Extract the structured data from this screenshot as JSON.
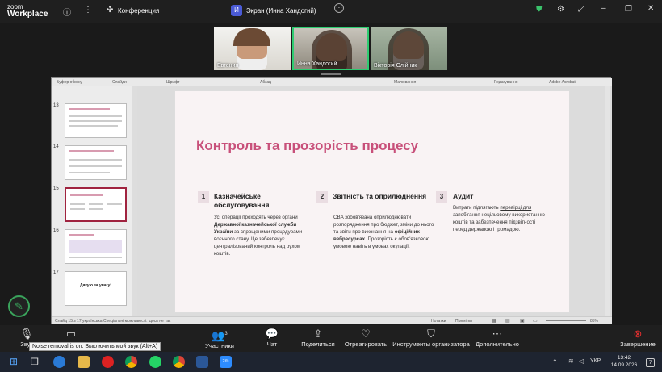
{
  "app": {
    "brand_line1": "zoom",
    "brand_line2": "Workplace"
  },
  "topbar": {
    "meeting_title": "Конференция",
    "share_label": "Экран (Инна Хандогий)",
    "share_avatar_letter": "И"
  },
  "participants": [
    {
      "name": "Евгения"
    },
    {
      "name": "Инна Хандогий"
    },
    {
      "name": "Вікторія Олійник"
    }
  ],
  "ribbon": {
    "items": [
      "Буфер обміну",
      "Слайди",
      "Шрифт",
      "Абзац",
      "Малювання",
      "Редагування",
      "Adobe Acrobat"
    ]
  },
  "thumbnails": [
    {
      "num": "13"
    },
    {
      "num": "14"
    },
    {
      "num": "15"
    },
    {
      "num": "16"
    },
    {
      "num": "17",
      "text": "Дякую за увагу!"
    }
  ],
  "slide": {
    "title": "Контроль та прозорість процесу",
    "columns": [
      {
        "num": "1",
        "heading": "Казначейське обслуговування",
        "text_pre": "Усі операції проходять через органи ",
        "text_bold": "Державної казначейської служби України",
        "text_post": " за спрощеними процедурами воєнного стану. Це забезпечує централізований контроль над рухом коштів."
      },
      {
        "num": "2",
        "heading": "Звітність та оприлюднення",
        "text_pre": "CBA зобов'язана оприлюднювати розпорядження про бюджет, зміни до нього та звіти про виконання на ",
        "text_bold": "офіційних вебресурсах",
        "text_post": ". Прозорість є обов'язковою умовою навіть в умовах окупації."
      },
      {
        "num": "3",
        "heading": "Аудит",
        "text_pre": "Витрати підлягають ",
        "text_bold": "перевірці для",
        "text_post": " запобігання нецільовому використанню коштів та забезпечення підзвітності перед державою і громадою."
      }
    ]
  },
  "statusbar": {
    "left": "Слайд 15 з 17   українська   Спеціальні можливості: щось не так",
    "notes": "Нотатки",
    "comments": "Примітки",
    "zoom": "85%"
  },
  "bottombar": {
    "audio": "Звук",
    "participants": "Участники",
    "participants_count": "3",
    "chat": "Чат",
    "share": "Поделиться",
    "react": "Отреагировать",
    "host_tools": "Инструменты организатора",
    "more": "Дополнительно",
    "end": "Завершение"
  },
  "tooltip": "Noise removal is on. Выключить мой звук (Alt+A)",
  "taskbar": {
    "lang": "УКР",
    "time": "13:42",
    "date": "14.09.2026",
    "notif": "7"
  },
  "colors": {
    "accent": "#c8507a",
    "end_red": "#e02f2f",
    "zoom_blue": "#2d8cff"
  }
}
